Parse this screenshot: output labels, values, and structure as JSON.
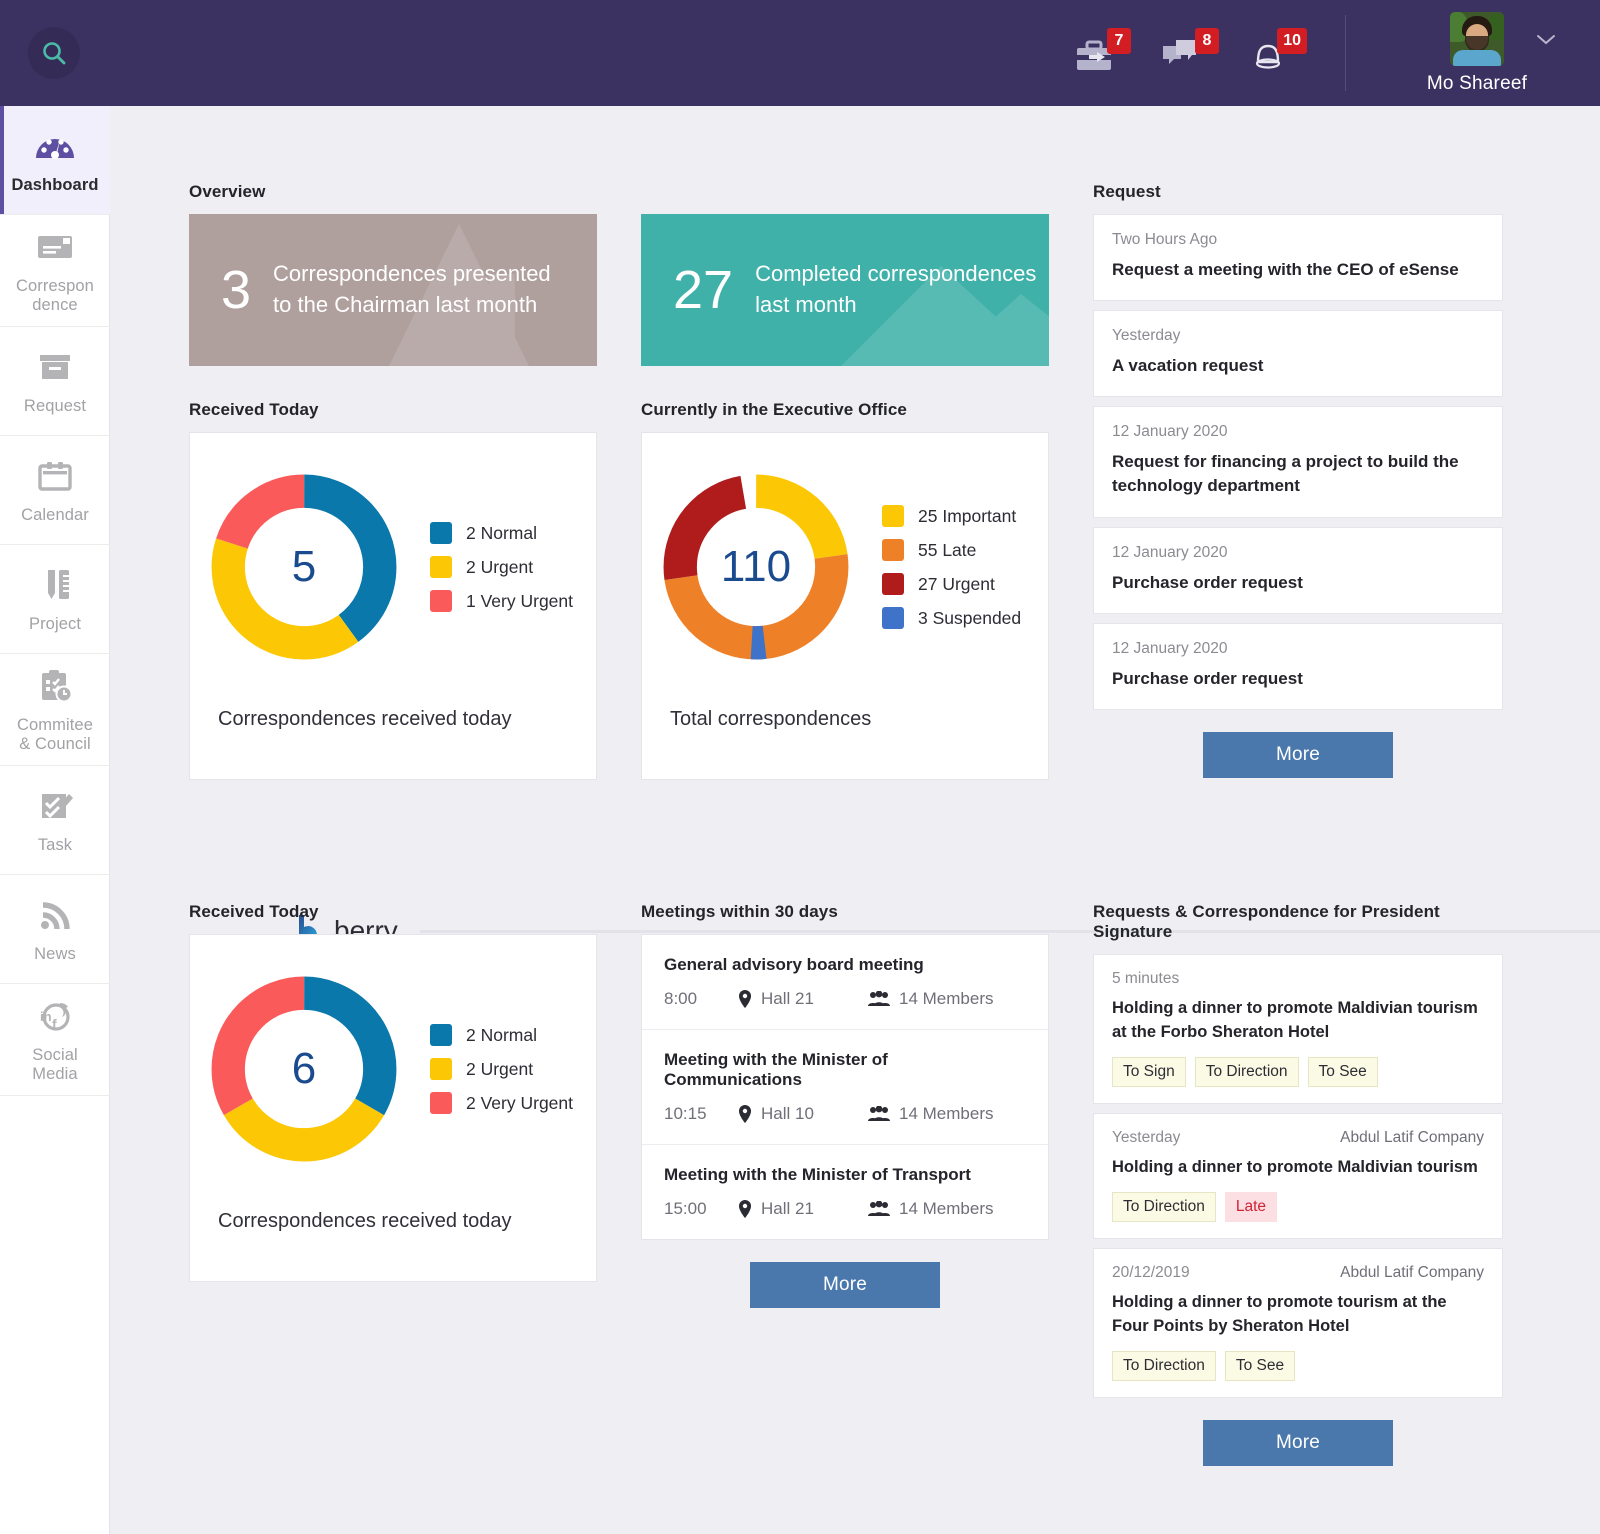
{
  "topbar": {
    "search_icon": "search-icon",
    "icons": [
      {
        "name": "briefcase-icon",
        "badge": "7"
      },
      {
        "name": "chat-icon",
        "badge": "8"
      },
      {
        "name": "bell-icon",
        "badge": "10"
      }
    ],
    "user": {
      "name": "Mo Shareef",
      "avatar": "user-avatar",
      "chevron": "chevron-down-icon"
    }
  },
  "sidebar": {
    "items": [
      {
        "label": "Dashboard",
        "icon": "dashboard-gauge-icon",
        "active": true
      },
      {
        "label": "Correspon\ndence",
        "icon": "envelope-icon",
        "active": false
      },
      {
        "label": "Request",
        "icon": "archive-box-icon",
        "active": false
      },
      {
        "label": "Calendar",
        "icon": "calendar-icon",
        "active": false
      },
      {
        "label": "Project",
        "icon": "ruler-pen-icon",
        "active": false
      },
      {
        "label": "Commitee\n& Council",
        "icon": "clipboard-clock-icon",
        "active": false
      },
      {
        "label": "Task",
        "icon": "task-check-icon",
        "active": false
      },
      {
        "label": "News",
        "icon": "rss-icon",
        "active": false
      },
      {
        "label": "Social\nMedia",
        "icon": "social-media-icon",
        "active": false
      }
    ]
  },
  "overview": {
    "label": "Overview",
    "tiles": [
      {
        "value": "3",
        "text": "Correspondences presented to the Chairman last month",
        "color": "#b0a09d"
      },
      {
        "value": "27",
        "text": "Completed correspondences last month",
        "color": "#3fb1a9"
      }
    ]
  },
  "received_today": {
    "label": "Received Today",
    "caption": "Correspondences received today"
  },
  "executive_office": {
    "label": "Currently in the Executive Office",
    "caption": "Total correspondences"
  },
  "request_panel": {
    "label": "Request",
    "more_label": "More",
    "items": [
      {
        "date": "Two Hours Ago",
        "title": "Request a meeting with the CEO of eSense"
      },
      {
        "date": "Yesterday",
        "title": "A vacation request"
      },
      {
        "date": "12 January 2020",
        "title": "Request for financing a project to build the technology department"
      },
      {
        "date": "12 January 2020",
        "title": "Purchase order request"
      },
      {
        "date": "12 January 2020",
        "title": "Purchase order request"
      }
    ]
  },
  "berry": {
    "name": "berry",
    "logo": "berry-logo-icon"
  },
  "received_today_2": {
    "label": "Received Today",
    "caption": "Correspondences received today"
  },
  "meetings": {
    "label": "Meetings within 30 days",
    "more_label": "More",
    "items": [
      {
        "title": "General advisory board meeting",
        "time": "8:00",
        "hall": "Hall 21",
        "members": "14 Members"
      },
      {
        "title": "Meeting with the Minister of Communications",
        "time": "10:15",
        "hall": "Hall 10",
        "members": "14 Members"
      },
      {
        "title": "Meeting with the Minister of Transport",
        "time": "15:00",
        "hall": "Hall 21",
        "members": "14 Members"
      }
    ]
  },
  "signature": {
    "label": "Requests & Correspondence for President Signature",
    "more_label": "More",
    "items": [
      {
        "date": "5 minutes",
        "org": "",
        "title": "Holding a dinner to promote Maldivian tourism at the Forbo Sheraton Hotel",
        "tags": [
          {
            "text": "To Sign",
            "late": false
          },
          {
            "text": "To Direction",
            "late": false
          },
          {
            "text": "To See",
            "late": false
          }
        ]
      },
      {
        "date": "Yesterday",
        "org": "Abdul Latif Company",
        "title": "Holding a dinner to promote Maldivian tourism",
        "tags": [
          {
            "text": "To Direction",
            "late": false
          },
          {
            "text": "Late",
            "late": true
          }
        ]
      },
      {
        "date": "20/12/2019",
        "org": "Abdul Latif Company",
        "title": "Holding a dinner to promote tourism at the Four Points by Sheraton Hotel",
        "tags": [
          {
            "text": "To Direction",
            "late": false
          },
          {
            "text": "To See",
            "late": false
          }
        ]
      }
    ]
  },
  "chart_data": [
    {
      "type": "pie",
      "title": "Received Today",
      "subtitle": "Correspondences received today",
      "center_value": 5,
      "categories": [
        "Normal",
        "Urgent",
        "Very Urgent"
      ],
      "values": [
        2,
        2,
        1
      ],
      "colors": [
        "#0b78ab",
        "#fcc705",
        "#fb5a5a"
      ],
      "legend": "right",
      "legend_entries": [
        "2 Normal",
        "2 Urgent",
        "1 Very Urgent"
      ]
    },
    {
      "type": "pie",
      "title": "Currently in the Executive Office",
      "subtitle": "Total correspondences",
      "center_value": 110,
      "categories": [
        "Important",
        "Late",
        "Urgent",
        "Suspended"
      ],
      "values": [
        25,
        55,
        27,
        3
      ],
      "colors": [
        "#fcc705",
        "#ee8028",
        "#b01c1c",
        "#3e73c9"
      ],
      "legend": "right",
      "legend_entries": [
        "25 Important",
        "55 Late",
        "27 Urgent",
        "3 Suspended"
      ]
    },
    {
      "type": "pie",
      "title": "Received Today",
      "subtitle": "Correspondences received today",
      "center_value": 6,
      "categories": [
        "Normal",
        "Urgent",
        "Very Urgent"
      ],
      "values": [
        2,
        2,
        2
      ],
      "colors": [
        "#0b78ab",
        "#fcc705",
        "#fb5a5a"
      ],
      "legend": "right",
      "legend_entries": [
        "2 Normal",
        "2 Urgent",
        "2 Very Urgent"
      ]
    }
  ],
  "colors": {
    "topbar": "#3b3261",
    "accent": "#5e4fa2",
    "button": "#4a78ad",
    "badge": "#d21d23",
    "page_bg": "#eeeef3"
  }
}
